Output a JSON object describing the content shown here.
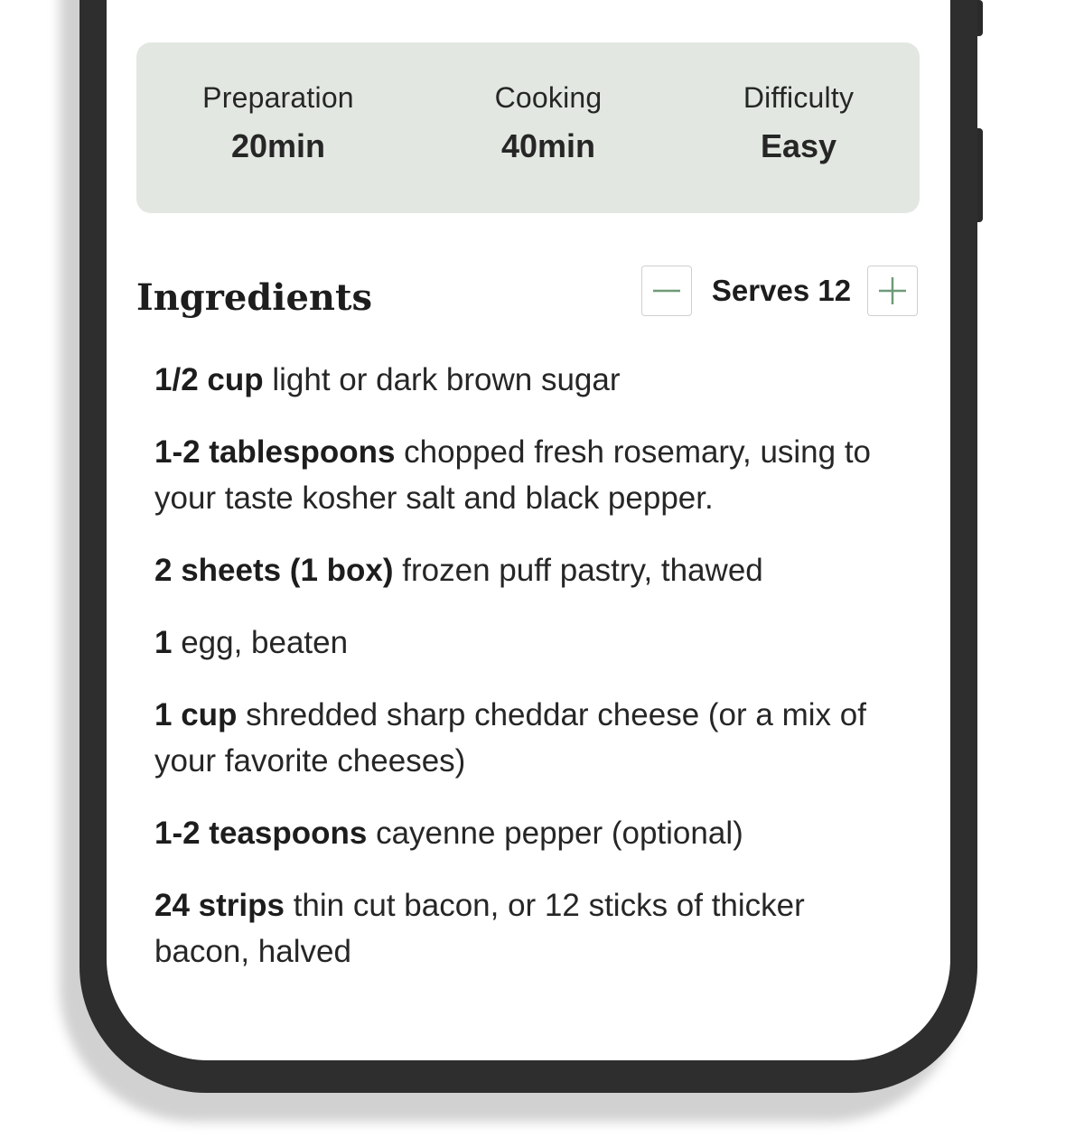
{
  "recipe_info": {
    "preparation": {
      "label": "Preparation",
      "value": "20min"
    },
    "cooking": {
      "label": "Cooking",
      "value": "40min"
    },
    "difficulty": {
      "label": "Difficulty",
      "value": "Easy"
    }
  },
  "ingredients": {
    "title": "Ingredients",
    "serves_label": "Serves 12",
    "decrease_icon": "minus-icon",
    "increase_icon": "plus-icon",
    "accent_color": "#6f9a78",
    "items": [
      {
        "quantity": "1/2 cup",
        "text": " light or dark brown sugar"
      },
      {
        "quantity": "1-2 tablespoons",
        "text": " chopped fresh rosemary, using to your taste kosher salt and black pepper."
      },
      {
        "quantity": "2 sheets (1 box)",
        "text": " frozen puff pastry, thawed"
      },
      {
        "quantity": "1",
        "text": " egg, beaten"
      },
      {
        "quantity": "1 cup",
        "text": " shredded sharp cheddar cheese (or a mix of your favorite cheeses)"
      },
      {
        "quantity": "1-2 teaspoons",
        "text": " cayenne pepper (optional)"
      },
      {
        "quantity": "24 strips",
        "text": " thin cut bacon, or 12 sticks of thicker bacon, halved"
      }
    ]
  },
  "colors": {
    "info_card_bg": "#e2e8e1",
    "phone_frame": "#2e2e2e"
  }
}
